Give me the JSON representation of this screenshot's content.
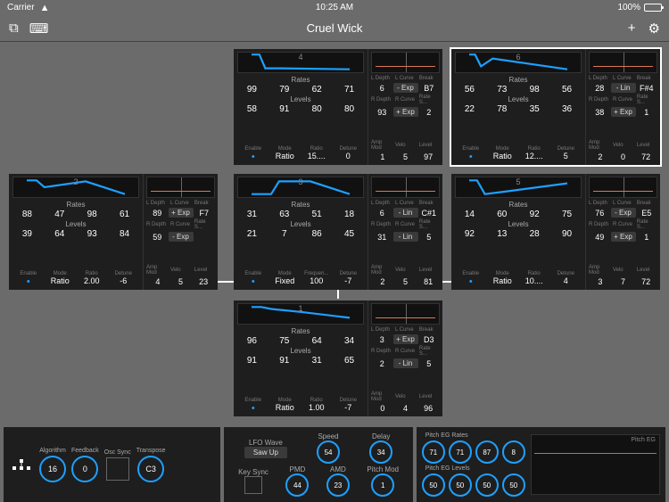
{
  "status": {
    "carrier": "Carrier",
    "time": "10:25 AM",
    "battery": "100%"
  },
  "title": "Cruel Wick",
  "labels": {
    "rates": "Rates",
    "levels": "Levels",
    "enable": "Enable",
    "mode": "Mode",
    "ratio": "Ratio",
    "detune": "Detune",
    "ampmod": "Amp Mod",
    "velo": "Velo",
    "level": "Level",
    "ldepth": "L Depth",
    "lcurve": "L Curve",
    "break": "Break",
    "rdepth": "R Depth",
    "rcurve": "R Curve",
    "rates_s": "Rate S..."
  },
  "ops": {
    "4": {
      "rates": [
        "99",
        "79",
        "62",
        "71"
      ],
      "levels": [
        "58",
        "91",
        "80",
        "80"
      ],
      "mode": "Ratio",
      "ratio": "15....",
      "detune": "0",
      "ldepth": "6",
      "lcurve": "- Exp",
      "break": "B7",
      "rdepth": "93",
      "rcurve": "+ Exp",
      "rates_s": "2",
      "ampmod": "1",
      "velo": "5",
      "level": "97"
    },
    "6": {
      "rates": [
        "56",
        "73",
        "98",
        "56"
      ],
      "levels": [
        "22",
        "78",
        "35",
        "36"
      ],
      "mode": "Ratio",
      "ratio": "12....",
      "detune": "5",
      "ldepth": "28",
      "lcurve": "- Lin",
      "break": "F#4",
      "rdepth": "38",
      "rcurve": "+ Exp",
      "rates_s": "1",
      "ampmod": "2",
      "velo": "0",
      "level": "72"
    },
    "2": {
      "rates": [
        "88",
        "47",
        "98",
        "61"
      ],
      "levels": [
        "39",
        "64",
        "93",
        "84"
      ],
      "mode": "Ratio",
      "ratio": "2.00",
      "detune": "-6",
      "ldepth": "89",
      "lcurve": "+ Exp",
      "break": "F7",
      "rdepth": "59",
      "rcurve": "- Exp",
      "rates_s": "",
      "ampmod": "4",
      "velo": "5",
      "level": "23"
    },
    "3": {
      "rates": [
        "31",
        "63",
        "51",
        "18"
      ],
      "levels": [
        "21",
        "7",
        "86",
        "45"
      ],
      "mode": "Fixed",
      "ratio": "100",
      "detune": "-7",
      "ldepth": "6",
      "lcurve": "- Lin",
      "break": "C#1",
      "rdepth": "31",
      "rcurve": "- Lin",
      "rates_s": "5",
      "ampmod": "2",
      "velo": "5",
      "level": "81",
      "ratio_lbl": "Frequen..."
    },
    "5": {
      "rates": [
        "14",
        "60",
        "92",
        "75"
      ],
      "levels": [
        "92",
        "13",
        "28",
        "90"
      ],
      "mode": "Ratio",
      "ratio": "10....",
      "detune": "4",
      "ldepth": "76",
      "lcurve": "- Exp",
      "break": "E5",
      "rdepth": "49",
      "rcurve": "+ Exp",
      "rates_s": "1",
      "ampmod": "3",
      "velo": "7",
      "level": "72"
    },
    "1": {
      "rates": [
        "96",
        "75",
        "64",
        "34"
      ],
      "levels": [
        "91",
        "91",
        "31",
        "65"
      ],
      "mode": "Ratio",
      "ratio": "1.00",
      "detune": "-7",
      "ldepth": "3",
      "lcurve": "+ Exp",
      "break": "D3",
      "rdepth": "2",
      "rcurve": "- Lin",
      "rates_s": "5",
      "ampmod": "0",
      "velo": "4",
      "level": "96"
    }
  },
  "global": {
    "algorithm_lbl": "Algorithm",
    "feedback_lbl": "Feedback",
    "oscsync_lbl": "Osc Sync",
    "transpose_lbl": "Transpose",
    "algorithm": "16",
    "feedback": "0",
    "transpose": "C3",
    "lfowave_lbl": "LFO Wave",
    "lfowave": "Saw Up",
    "speed_lbl": "Speed",
    "speed": "54",
    "delay_lbl": "Delay",
    "delay": "34",
    "keysync_lbl": "Key Sync",
    "pmd_lbl": "PMD",
    "pmd": "44",
    "amd_lbl": "AMD",
    "amd": "23",
    "pitchmod_lbl": "Pitch Mod",
    "pitchmod": "1",
    "pegrates_lbl": "Pitch EG Rates",
    "pegrates": [
      "71",
      "71",
      "87",
      "8"
    ],
    "peglevels_lbl": "Pitch EG Levels",
    "peglevels": [
      "50",
      "50",
      "50",
      "50"
    ],
    "pitcheg_lbl": "Pitch EG"
  }
}
